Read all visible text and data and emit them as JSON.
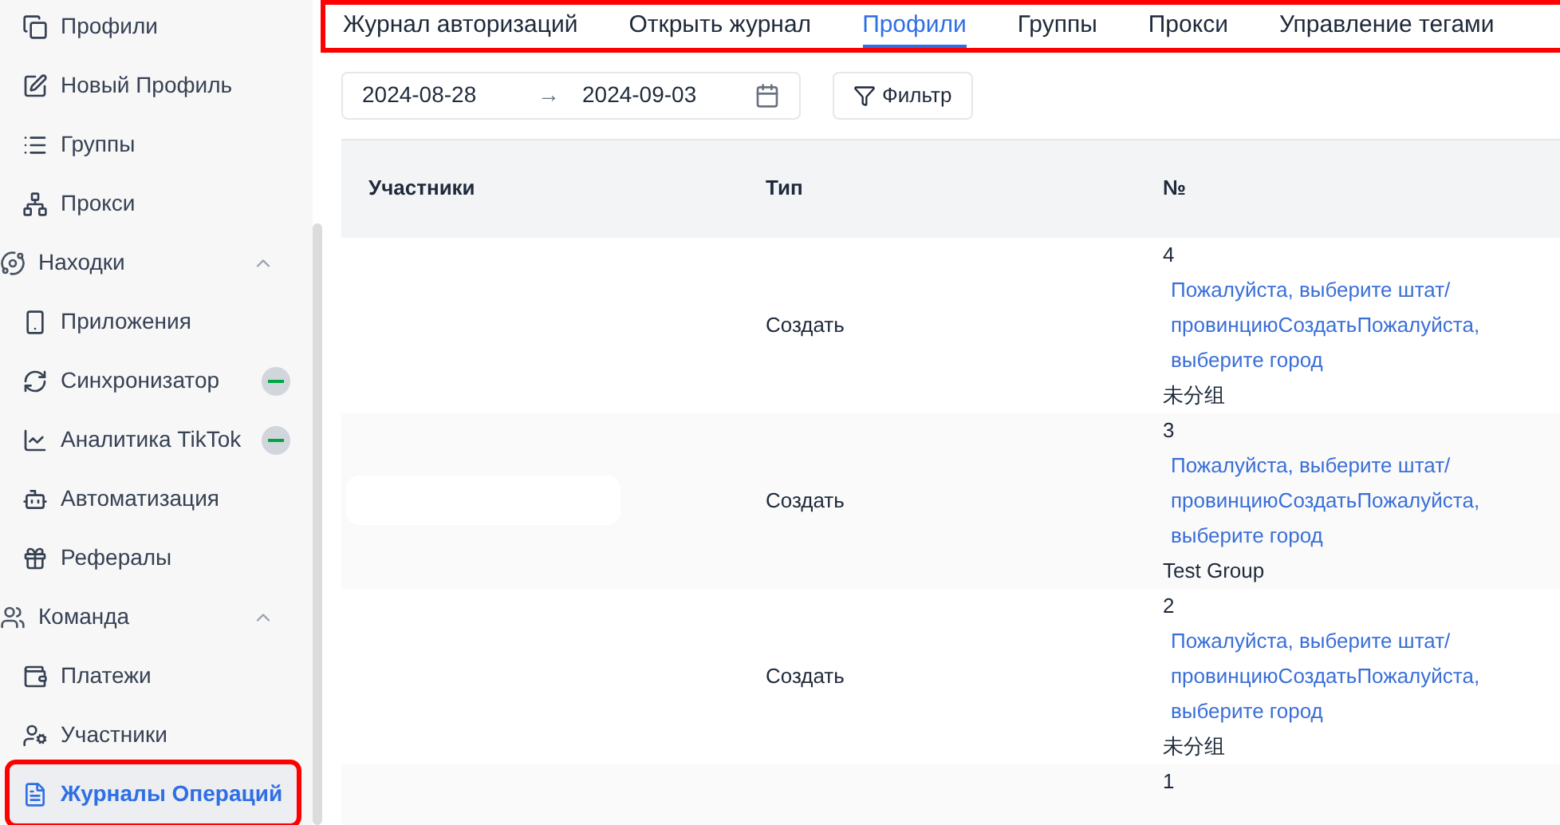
{
  "sidebar": {
    "items": [
      {
        "kind": "item",
        "label": "Профили",
        "selected": false,
        "badge": false,
        "highlighted": false
      },
      {
        "kind": "item",
        "label": "Новый Профиль",
        "selected": false,
        "badge": false,
        "highlighted": false
      },
      {
        "kind": "item",
        "label": "Группы",
        "selected": false,
        "badge": false,
        "highlighted": false
      },
      {
        "kind": "item",
        "label": "Прокси",
        "selected": false,
        "badge": false,
        "highlighted": false
      },
      {
        "kind": "section",
        "label": "Находки",
        "expanded": true
      },
      {
        "kind": "item",
        "label": "Приложения",
        "selected": false,
        "badge": false,
        "highlighted": false
      },
      {
        "kind": "item",
        "label": "Синхронизатор",
        "selected": false,
        "badge": true,
        "highlighted": false
      },
      {
        "kind": "item",
        "label": "Аналитика TikTok",
        "selected": false,
        "badge": true,
        "highlighted": false
      },
      {
        "kind": "item",
        "label": "Автоматизация",
        "selected": false,
        "badge": false,
        "highlighted": false
      },
      {
        "kind": "item",
        "label": "Рефералы",
        "selected": false,
        "badge": false,
        "highlighted": false
      },
      {
        "kind": "section",
        "label": "Команда",
        "expanded": true
      },
      {
        "kind": "item",
        "label": "Платежи",
        "selected": false,
        "badge": false,
        "highlighted": false
      },
      {
        "kind": "item",
        "label": "Участники",
        "selected": false,
        "badge": false,
        "highlighted": false
      },
      {
        "kind": "item",
        "label": "Журналы Операций",
        "selected": true,
        "badge": false,
        "highlighted": true
      }
    ]
  },
  "tabs": {
    "highlighted": true,
    "items": [
      {
        "label": "Журнал авторизаций",
        "selected": false
      },
      {
        "label": "Открыть журнал",
        "selected": false
      },
      {
        "label": "Профили",
        "selected": true
      },
      {
        "label": "Группы",
        "selected": false
      },
      {
        "label": "Прокси",
        "selected": false
      },
      {
        "label": "Управление тегами",
        "selected": false
      }
    ]
  },
  "date_range": {
    "start": "2024-08-28",
    "separator": "→",
    "end": "2024-09-03"
  },
  "filter_button": "Фильтр",
  "table": {
    "columns": [
      "Участники",
      "Тип",
      "№"
    ],
    "rows": [
      {
        "masked": false,
        "type": "Создать",
        "number": "4",
        "link": "Пожалуйста, выберите штат/провинциюСоздатьПожалуйста, выберите город",
        "group": "未分组"
      },
      {
        "masked": true,
        "type": "Создать",
        "number": "3",
        "link": "Пожалуйста, выберите штат/провинциюСоздатьПожалуйста, выберите город",
        "group": "Test Group"
      },
      {
        "masked": false,
        "type": "Создать",
        "number": "2",
        "link": "Пожалуйста, выберите штат/провинциюСоздатьПожалуйста, выберите город",
        "group": "未分组"
      },
      {
        "masked": false,
        "number": "1"
      }
    ]
  }
}
